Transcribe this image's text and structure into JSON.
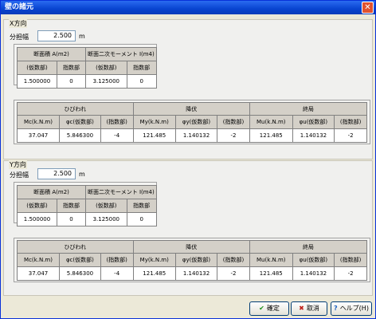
{
  "window": {
    "title": "壁の諸元",
    "close": "✕"
  },
  "x_section": {
    "label": "X方向",
    "share_label": "分担幅",
    "share_value": "2.500",
    "share_unit": "m",
    "area_header": "断面積 A(m2)",
    "moment_header": "断面二次モーメント I(m4)",
    "sub_headers": [
      "(仮数部)",
      "指数部",
      "(仮数部)",
      "指数部"
    ],
    "values": [
      "1.500000",
      "0",
      "3.125000",
      "0"
    ],
    "crack_header": "ひびわれ",
    "yield_header": "降伏",
    "ultimate_header": "終局",
    "col_headers": [
      "Mc(k.N.m)",
      "φc(仮数部)",
      "(指数部)",
      "My(k.N.m)",
      "φy(仮数部)",
      "(指数部)",
      "Mu(k.N.m)",
      "φu(仮数部)",
      "(指数部)"
    ],
    "row": [
      "37.047",
      "5.846300",
      "-4",
      "121.485",
      "1.140132",
      "-2",
      "121.485",
      "1.140132",
      "-2"
    ]
  },
  "y_section": {
    "label": "Y方向",
    "share_label": "分担幅",
    "share_value": "2.500",
    "share_unit": "m",
    "area_header": "断面積 A(m2)",
    "moment_header": "断面二次モーメント I(m4)",
    "sub_headers": [
      "(仮数部)",
      "指数部",
      "(仮数部)",
      "指数部"
    ],
    "values": [
      "1.500000",
      "0",
      "3.125000",
      "0"
    ],
    "crack_header": "ひびわれ",
    "yield_header": "降伏",
    "ultimate_header": "終局",
    "col_headers": [
      "Mc(k.N.m)",
      "φc(仮数部)",
      "(指数部)",
      "My(k.N.m)",
      "φy(仮数部)",
      "(指数部)",
      "Mu(k.N.m)",
      "φu(仮数部)",
      "(指数部)"
    ],
    "row": [
      "37.047",
      "5.846300",
      "-4",
      "121.485",
      "1.140132",
      "-2",
      "121.485",
      "1.140132",
      "-2"
    ]
  },
  "buttons": {
    "ok": "確定",
    "cancel": "取消",
    "help": "ヘルプ(H)"
  }
}
